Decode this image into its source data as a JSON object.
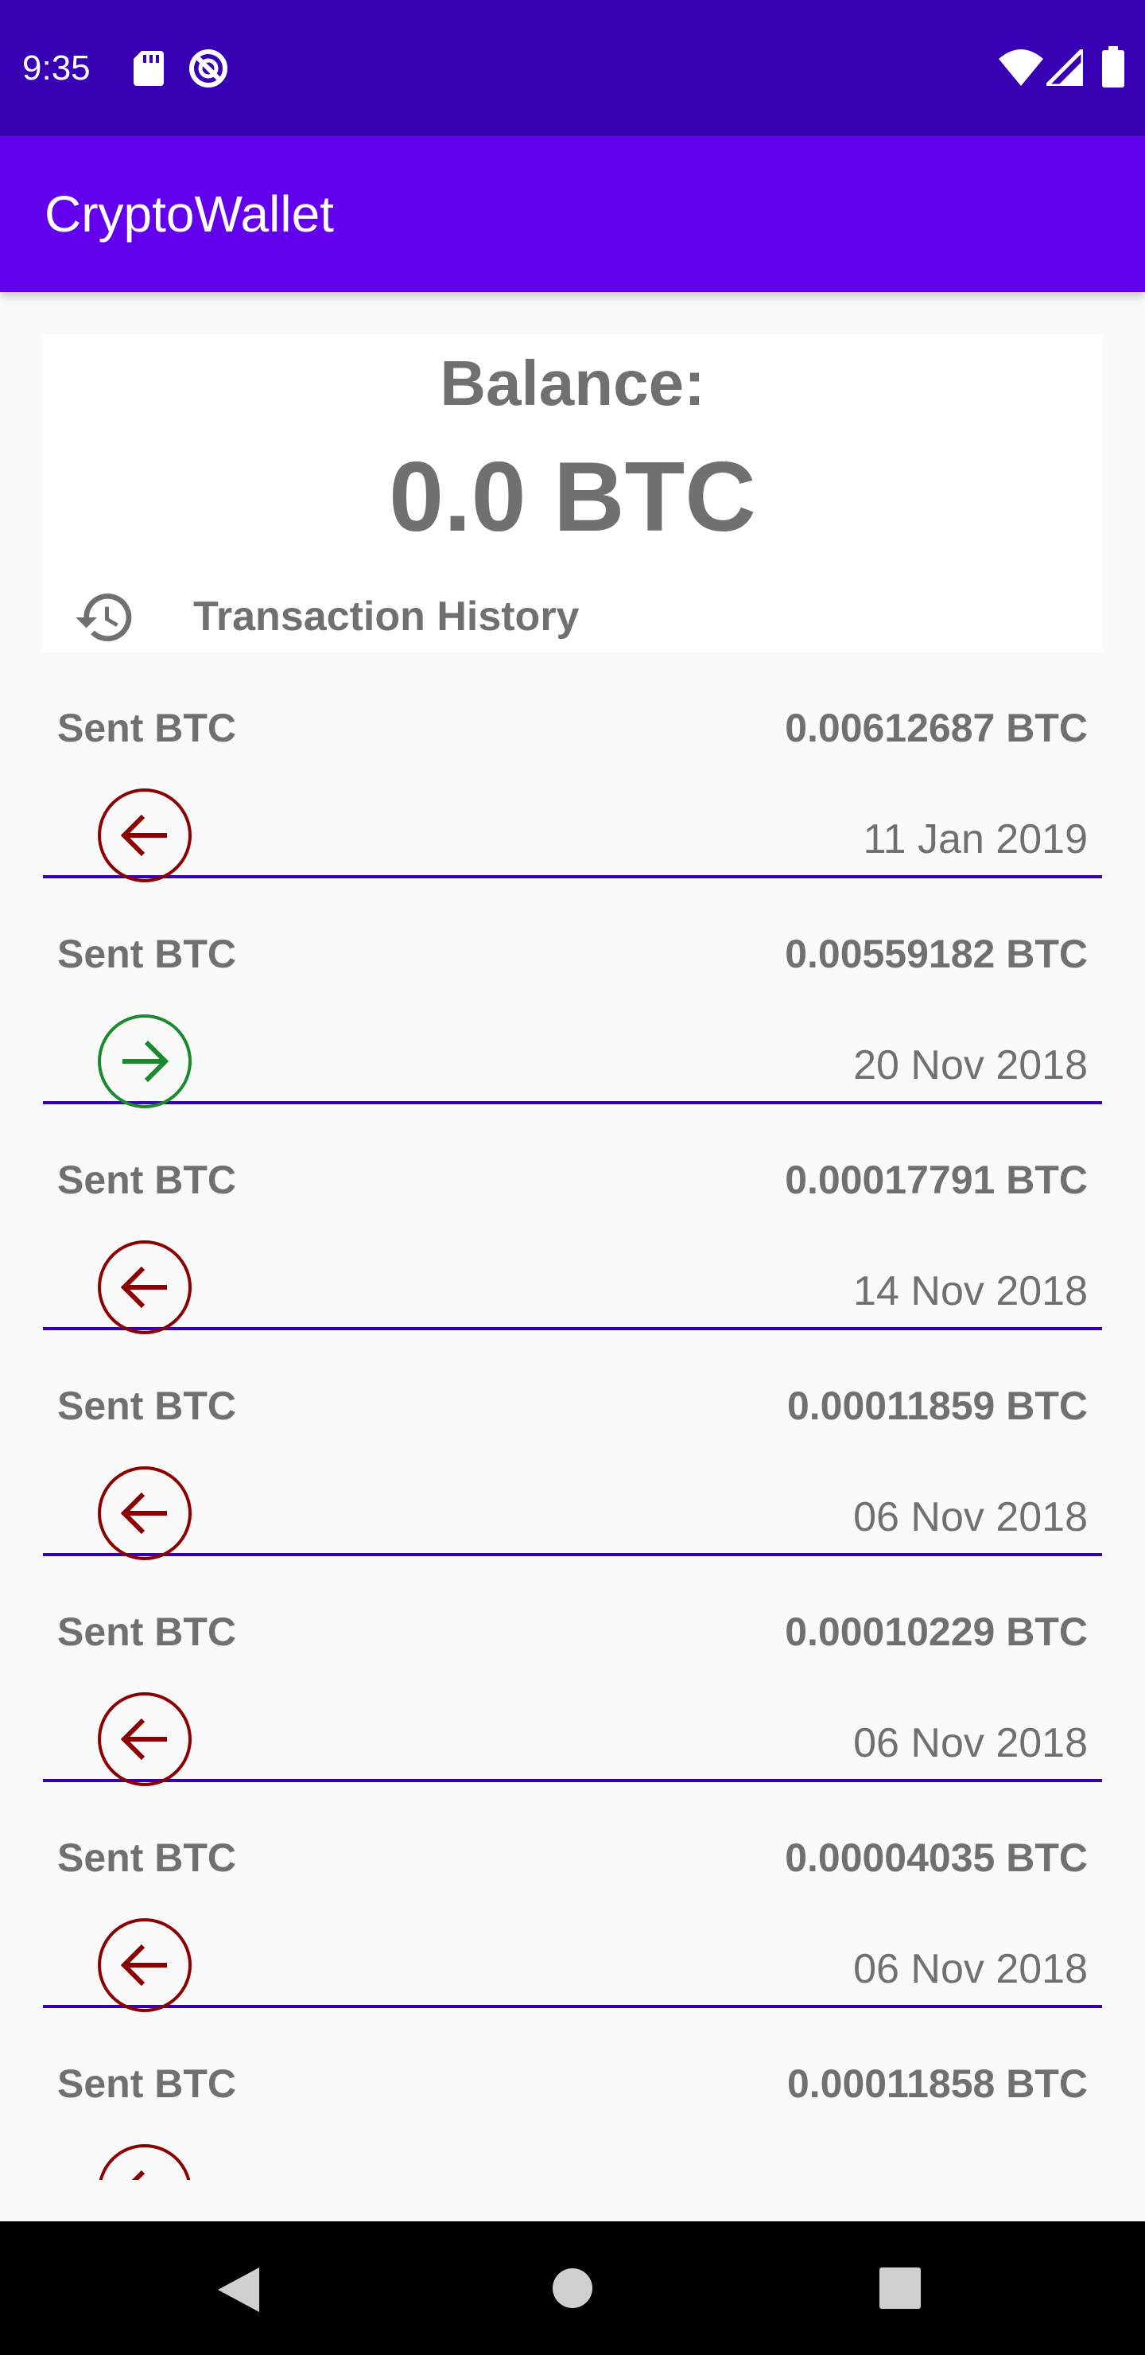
{
  "status_bar": {
    "time": "9:35",
    "icons": [
      "sd-card-icon",
      "do-not-disturb-icon",
      "wifi-icon",
      "cell-signal-icon",
      "battery-icon"
    ]
  },
  "app_bar": {
    "title": "CryptoWallet"
  },
  "balance": {
    "label": "Balance:",
    "value": "0.0 BTC"
  },
  "history": {
    "title": "Transaction History",
    "icon": "history-icon"
  },
  "colors": {
    "status_bar": "#3700b3",
    "app_bar": "#6200ee",
    "sent_icon": "#8b0000",
    "received_icon": "#1b8a2e",
    "divider": "#3700b3",
    "text": "#707070"
  },
  "transactions": [
    {
      "title": "Sent BTC",
      "amount": "0.00612687 BTC",
      "date": "11 Jan 2019",
      "direction": "sent"
    },
    {
      "title": "Sent BTC",
      "amount": "0.00559182 BTC",
      "date": "20 Nov 2018",
      "direction": "received"
    },
    {
      "title": "Sent BTC",
      "amount": "0.00017791 BTC",
      "date": "14 Nov 2018",
      "direction": "sent"
    },
    {
      "title": "Sent BTC",
      "amount": "0.00011859 BTC",
      "date": "06 Nov 2018",
      "direction": "sent"
    },
    {
      "title": "Sent BTC",
      "amount": "0.00010229 BTC",
      "date": "06 Nov 2018",
      "direction": "sent"
    },
    {
      "title": "Sent BTC",
      "amount": "0.00004035 BTC",
      "date": "06 Nov 2018",
      "direction": "sent"
    },
    {
      "title": "Sent BTC",
      "amount": "0.00011858 BTC",
      "date": "",
      "direction": "sent"
    }
  ],
  "nav_bar": {
    "buttons": [
      "back-icon",
      "home-icon",
      "recents-icon"
    ]
  }
}
